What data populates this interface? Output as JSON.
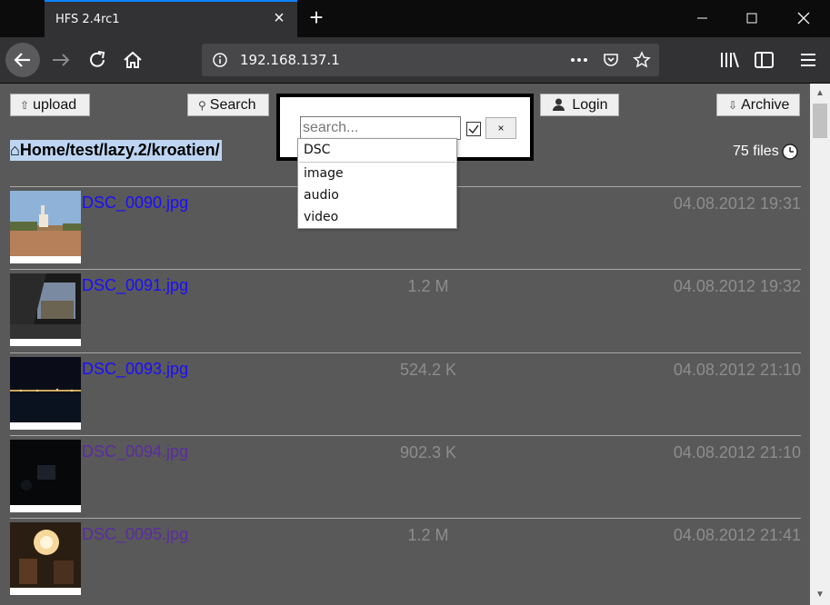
{
  "browser": {
    "tab_title": "HFS 2.4rc1",
    "url": "192.168.137.1"
  },
  "toolbar": {
    "upload_label": "upload",
    "search_label": "Search",
    "login_label": "Login",
    "archive_label": "Archive"
  },
  "breadcrumb": "⌂Home/test/lazy.2/kroatien/",
  "file_count": "75 files",
  "search": {
    "placeholder": "search...",
    "clear_label": "×",
    "suggestions": [
      "DSC",
      "image",
      "audio",
      "video"
    ]
  },
  "files": [
    {
      "name": "DSC_0090.jpg",
      "size": "",
      "date": "04.08.2012 19:31"
    },
    {
      "name": "DSC_0091.jpg",
      "size": "1.2 M",
      "date": "04.08.2012 19:32"
    },
    {
      "name": "DSC_0093.jpg",
      "size": "524.2 K",
      "date": "04.08.2012 21:10"
    },
    {
      "name": "DSC_0094.jpg",
      "size": "902.3 K",
      "date": "04.08.2012 21:10"
    },
    {
      "name": "DSC_0095.jpg",
      "size": "1.2 M",
      "date": "04.08.2012 21:41"
    }
  ],
  "colors": {
    "page_bg": "#595959",
    "link": "#1a0dff",
    "link_visited": "#5a2ca0",
    "muted": "#8d8d8d",
    "tab_accent": "#0a84ff"
  },
  "icons": {
    "upload": "up-arrow-icon",
    "search": "magnifier-icon",
    "login": "user-icon",
    "archive": "down-arrow-icon",
    "sort": "clock-icon"
  }
}
